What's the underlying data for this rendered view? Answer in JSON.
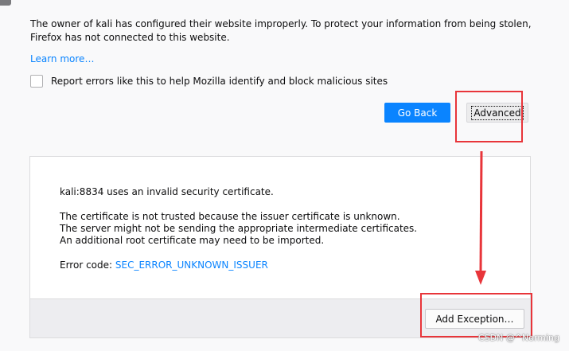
{
  "warning": {
    "intro_text": "The owner of kali has configured their website improperly. To protect your information from being stolen, Firefox has not connected to this website.",
    "learn_more": "Learn more…",
    "report_label": "Report errors like this to help Mozilla identify and block malicious sites"
  },
  "buttons": {
    "go_back": "Go Back",
    "advanced": "Advanced",
    "add_exception": "Add Exception…"
  },
  "advanced_panel": {
    "domain_line": "kali:8834 uses an invalid security certificate.",
    "cert_lines": [
      "The certificate is not trusted because the issuer certificate is unknown.",
      "The server might not be sending the appropriate intermediate certificates.",
      "An additional root certificate may need to be imported."
    ],
    "error_code_label": "Error code: ",
    "error_code": "SEC_ERROR_UNKNOWN_ISSUER"
  },
  "annotation": {
    "highlight_color": "#e8353a"
  },
  "watermark": "CSDN @^Norming",
  "colors": {
    "primary_button": "#0a84ff",
    "link": "#0a84ff",
    "page_background": "#f9f9fa"
  }
}
